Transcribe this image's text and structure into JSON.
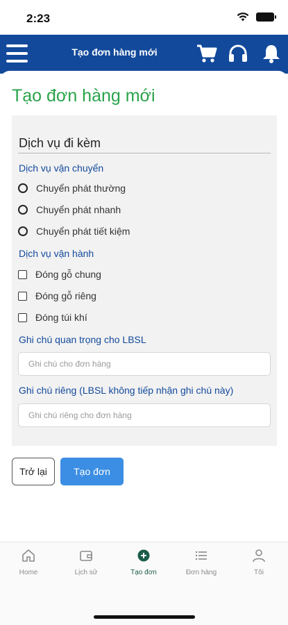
{
  "status_bar": {
    "time": "2:23",
    "icons": [
      "wifi-icon",
      "battery-icon"
    ]
  },
  "header": {
    "title": "Tạo đơn hàng mới",
    "background": "#12499b",
    "icons": [
      "menu-icon",
      "cart-icon",
      "headset-icon",
      "bell-icon"
    ]
  },
  "page": {
    "title": "Tạo đơn hàng mới",
    "title_color": "#2aa34a"
  },
  "form": {
    "section_title": "Dịch vụ đi kèm",
    "shipping": {
      "label": "Dịch vụ vận chuyển",
      "options": [
        "Chuyển phát thường",
        "Chuyển phát nhanh",
        "Chuyển phát tiết kiệm"
      ],
      "selected": null
    },
    "operation": {
      "label": "Dịch vụ vận hành",
      "options": [
        "Đóng gỗ chung",
        "Đóng gỗ riêng",
        "Đóng túi khí"
      ],
      "checked": [
        false,
        false,
        false
      ]
    },
    "note_important": {
      "label": "Ghi chú quan trọng cho LBSL",
      "placeholder": "Ghi chú cho đơn hàng",
      "value": ""
    },
    "note_private": {
      "label": "Ghi chú riêng (LBSL không tiếp nhận ghi chú này)",
      "placeholder": "Ghi chú riêng cho đơn hàng",
      "value": ""
    }
  },
  "buttons": {
    "back": "Trở lại",
    "create": "Tạo đơn",
    "create_color": "#3b8ee3"
  },
  "bottom_nav": {
    "active": "create",
    "items": [
      {
        "id": "home",
        "label": "Home",
        "icon": "home-icon"
      },
      {
        "id": "history",
        "label": "Lịch sử",
        "icon": "wallet-icon"
      },
      {
        "id": "create",
        "label": "Tạo đơn",
        "icon": "plus-circle-icon"
      },
      {
        "id": "orders",
        "label": "Đơn hàng",
        "icon": "list-icon"
      },
      {
        "id": "me",
        "label": "Tôi",
        "icon": "user-icon"
      }
    ]
  }
}
